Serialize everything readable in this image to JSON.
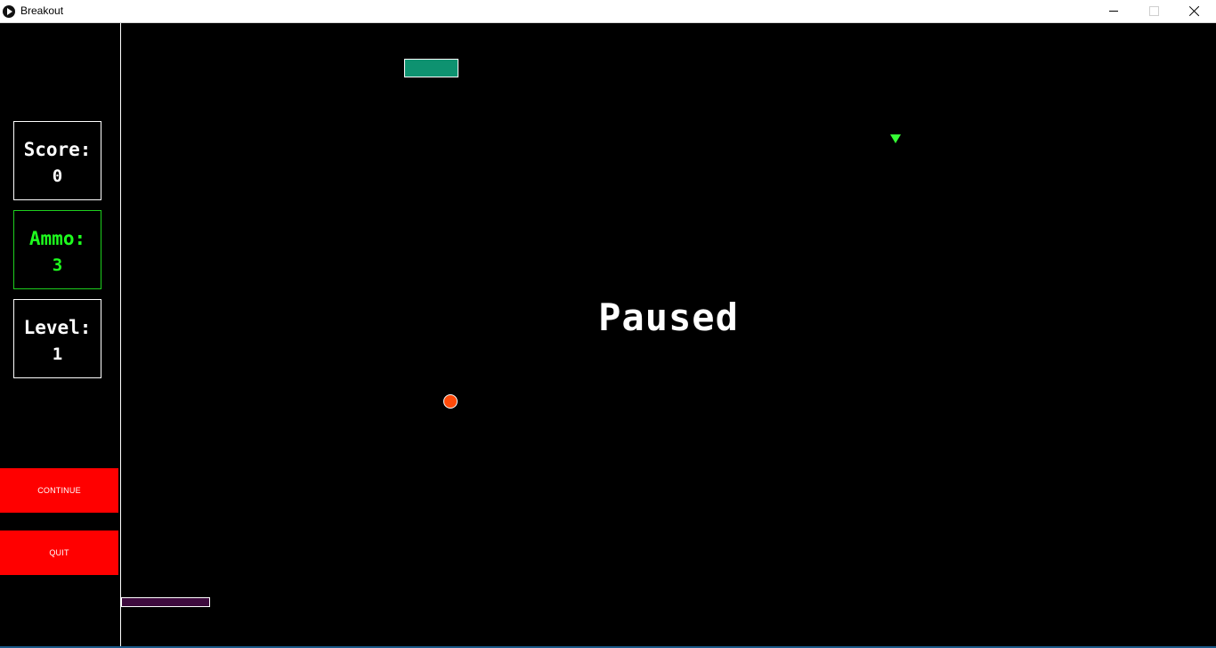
{
  "window": {
    "title": "Breakout"
  },
  "sidebar": {
    "score": {
      "label": "Score:",
      "value": "0"
    },
    "ammo": {
      "label": "Ammo:",
      "value": "3"
    },
    "level": {
      "label": "Level:",
      "value": "1"
    },
    "buttons": {
      "continue_label": "CONTINUE",
      "quit_label": "QUIT"
    }
  },
  "game": {
    "status_text": "Paused",
    "colors": {
      "brick": "#0e9270",
      "ball": "#ff4a0a",
      "paddle": "#3d0a3d",
      "powerup": "#35ff35",
      "ammo_accent": "#1eff1e",
      "button": "#ff0000"
    }
  }
}
